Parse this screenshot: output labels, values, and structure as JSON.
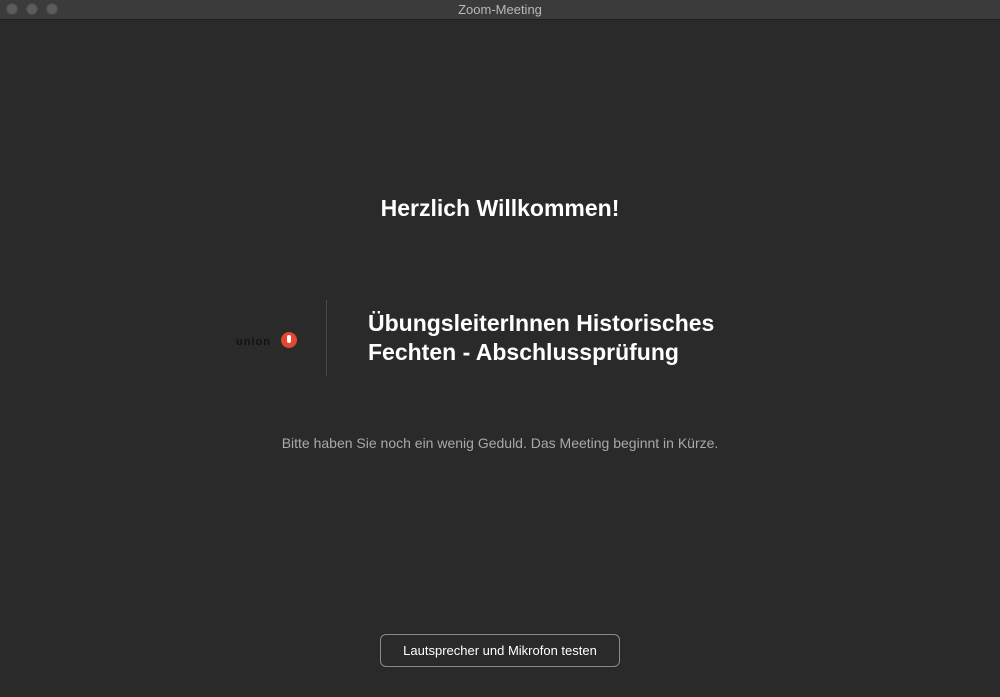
{
  "window": {
    "title": "Zoom-Meeting"
  },
  "main": {
    "welcome_heading": "Herzlich Willkommen!",
    "meeting_title": "ÜbungsleiterInnen Historisches Fechten - Abschlussprüfung",
    "logo_text": "union",
    "wait_message": "Bitte haben Sie noch ein wenig Geduld. Das Meeting beginnt in Kürze."
  },
  "footer": {
    "test_button_label": "Lautsprecher und Mikrofon testen"
  },
  "colors": {
    "background": "#2a2a2a",
    "titlebar": "#3b3b3b",
    "logo_accent": "#e4472f",
    "secondary_text": "#a9a9a9"
  }
}
